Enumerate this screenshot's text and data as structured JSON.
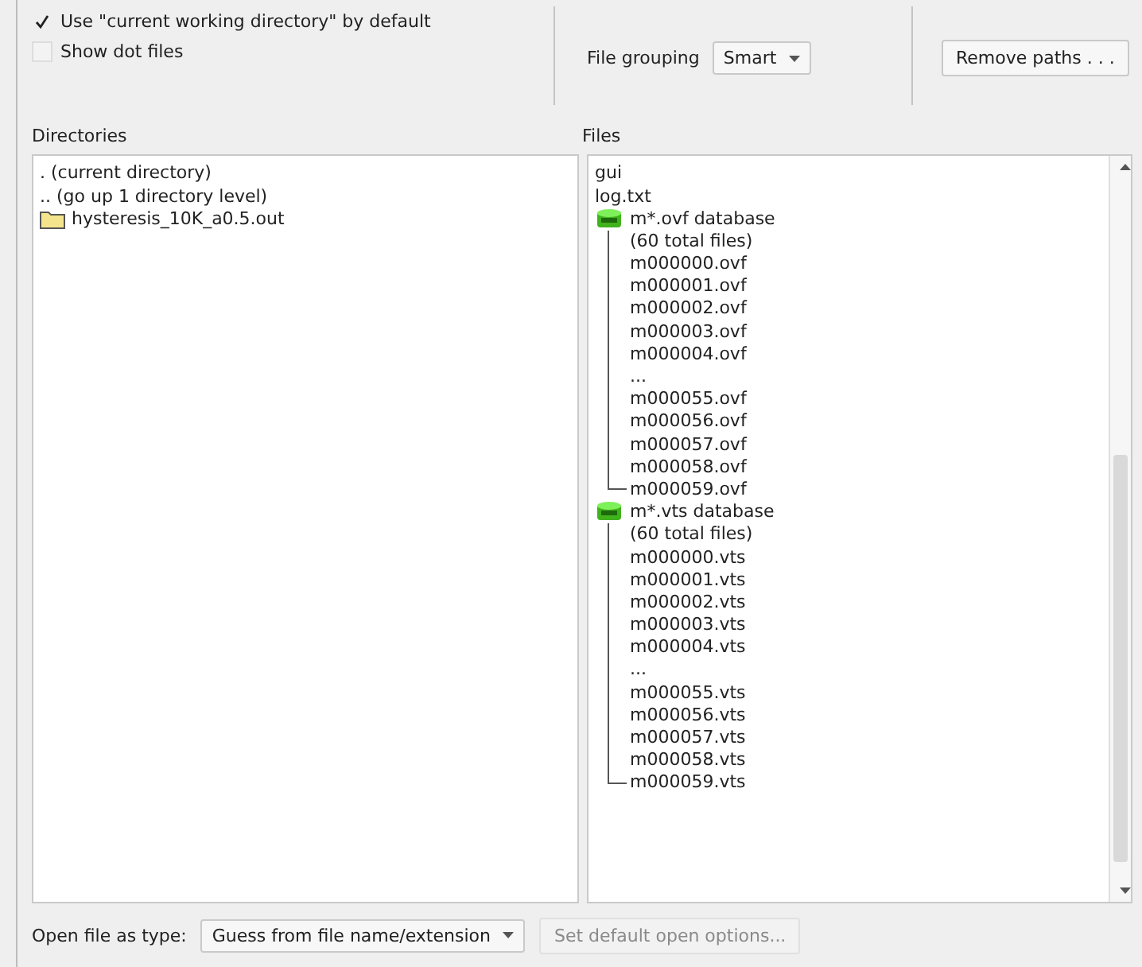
{
  "options": {
    "use_cwd": {
      "label": "Use \"current working directory\" by default",
      "checked": true
    },
    "show_dot_files": {
      "label": "Show dot files",
      "checked": false
    }
  },
  "file_grouping": {
    "label": "File grouping",
    "value": "Smart"
  },
  "remove_paths": {
    "label": "Remove paths . . ."
  },
  "directories": {
    "heading": "Directories",
    "items": [
      {
        "kind": "special",
        "name": ". (current directory)"
      },
      {
        "kind": "special",
        "name": ".. (go up 1 directory level)"
      },
      {
        "kind": "folder",
        "name": "hysteresis_10K_a0.5.out"
      }
    ]
  },
  "files": {
    "heading": "Files",
    "items": [
      {
        "kind": "file",
        "name": "gui"
      },
      {
        "kind": "file",
        "name": "log.txt"
      },
      {
        "kind": "database",
        "name": "m*.ovf database",
        "summary": "(60 total files)",
        "children": [
          "m000000.ovf",
          "m000001.ovf",
          "m000002.ovf",
          "m000003.ovf",
          "m000004.ovf",
          "...",
          "m000055.ovf",
          "m000056.ovf",
          "m000057.ovf",
          "m000058.ovf",
          "m000059.ovf"
        ]
      },
      {
        "kind": "database",
        "name": "m*.vts database",
        "summary": "(60 total files)",
        "children": [
          "m000000.vts",
          "m000001.vts",
          "m000002.vts",
          "m000003.vts",
          "m000004.vts",
          "...",
          "m000055.vts",
          "m000056.vts",
          "m000057.vts",
          "m000058.vts",
          "m000059.vts"
        ]
      }
    ]
  },
  "open_as": {
    "label": "Open file as type:",
    "value": "Guess from file name/extension"
  },
  "default_options": {
    "label": "Set default open options...",
    "disabled": true
  }
}
